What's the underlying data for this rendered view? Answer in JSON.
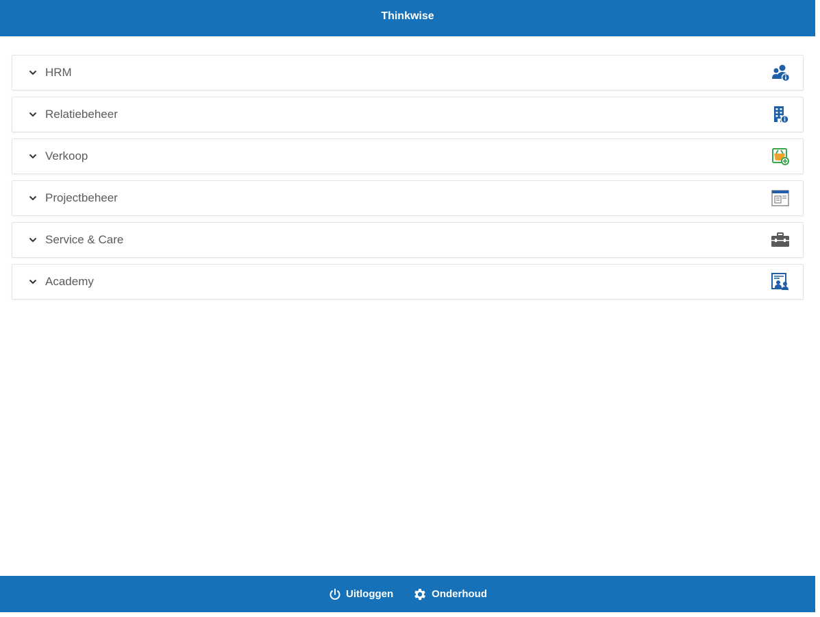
{
  "header": {
    "title": "Thinkwise"
  },
  "menu": {
    "items": [
      {
        "label": "HRM",
        "icon": "users-info-icon"
      },
      {
        "label": "Relatiebeheer",
        "icon": "building-info-icon"
      },
      {
        "label": "Verkoop",
        "icon": "sales-basket-icon"
      },
      {
        "label": "Projectbeheer",
        "icon": "project-calendar-icon"
      },
      {
        "label": "Service & Care",
        "icon": "toolbox-icon"
      },
      {
        "label": "Academy",
        "icon": "academy-certificate-icon"
      }
    ]
  },
  "footer": {
    "logout_label": "Uitloggen",
    "maintenance_label": "Onderhoud"
  },
  "colors": {
    "brand": "#1671b8",
    "icon_blue": "#1f5fa8",
    "icon_green": "#3aa64a",
    "icon_orange": "#f0a22e",
    "icon_gray": "#5a5a5a"
  }
}
